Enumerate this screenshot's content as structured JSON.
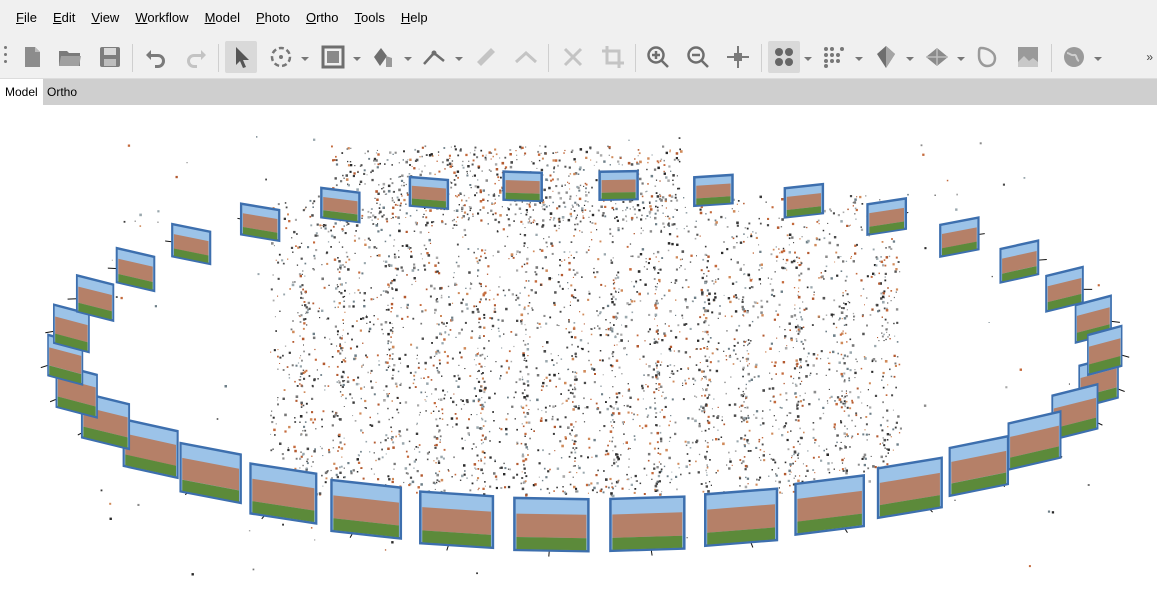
{
  "menu": [
    {
      "label": "File"
    },
    {
      "label": "Edit"
    },
    {
      "label": "View"
    },
    {
      "label": "Workflow"
    },
    {
      "label": "Model"
    },
    {
      "label": "Photo"
    },
    {
      "label": "Ortho"
    },
    {
      "label": "Tools"
    },
    {
      "label": "Help"
    }
  ],
  "tabs": [
    {
      "label": "Model",
      "active": true
    },
    {
      "label": "Ortho",
      "active": false
    }
  ],
  "toolbar_icons": [
    "new-document-icon",
    "open-folder-icon",
    "save-icon",
    "undo-icon",
    "redo-icon",
    "select-arrow-icon",
    "rotate-object-icon",
    "resize-region-icon",
    "navigation-hand-icon",
    "ruler-icon",
    "draw-polyline-icon",
    "delete-icon",
    "crop-icon",
    "zoom-in-icon",
    "zoom-out-icon",
    "reset-view-icon",
    "point-cloud-icon",
    "dense-cloud-icon",
    "shaded-model-icon",
    "tiled-model-icon",
    "texture-icon",
    "orthomosaic-icon",
    "globe-icon"
  ],
  "colors": {
    "toolbar_bg": "#f0f0f0",
    "tab_bar_bg": "#cfcfcf",
    "camera_frame": "#3d6fae"
  }
}
